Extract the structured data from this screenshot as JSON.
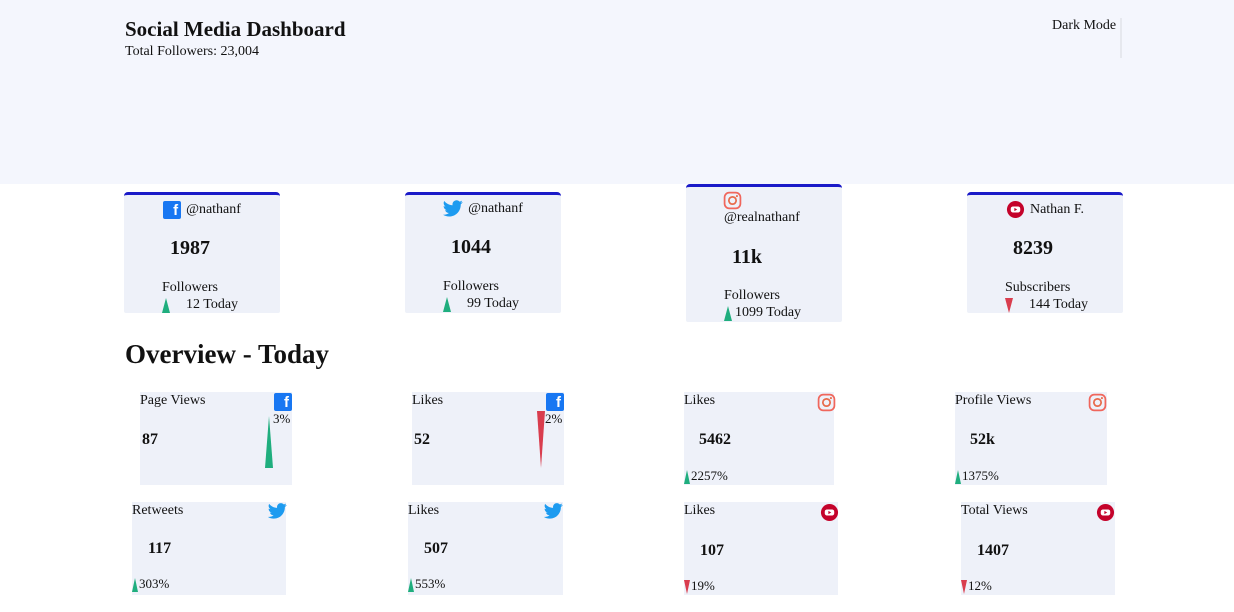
{
  "header": {
    "title": "Social Media Dashboard",
    "total_followers": "Total Followers: 23,004",
    "dark_mode_label": "Dark Mode"
  },
  "colors": {
    "card_accent": "#1a1ac8",
    "up": "#1fae7e",
    "down": "#d93d4e",
    "facebook": "#1877f2",
    "twitter": "#1d9bf0",
    "instagram": "#f58529",
    "youtube": "#c4032b"
  },
  "cards": [
    {
      "platform": "facebook",
      "icon": "facebook-icon",
      "handle": "@nathanf",
      "count": "1987",
      "unit": "Followers",
      "trend": "up",
      "today": "12 Today"
    },
    {
      "platform": "twitter",
      "icon": "twitter-icon",
      "handle": "@nathanf",
      "count": "1044",
      "unit": "Followers",
      "trend": "up",
      "today": "99 Today"
    },
    {
      "platform": "instagram",
      "icon": "instagram-icon",
      "handle": "@realnathanf",
      "count": "11k",
      "unit": "Followers",
      "trend": "up",
      "today": "1099 Today"
    },
    {
      "platform": "youtube",
      "icon": "youtube-icon",
      "handle": "Nathan F.",
      "count": "8239",
      "unit": "Subscribers",
      "trend": "down",
      "today": "144 Today"
    }
  ],
  "overview": {
    "title": "Overview - Today",
    "items": [
      {
        "label": "Page Views",
        "icon": "facebook-icon",
        "value": "87",
        "trend": "up",
        "pct": "3%"
      },
      {
        "label": "Likes",
        "icon": "facebook-icon",
        "value": "52",
        "trend": "down",
        "pct": "2%"
      },
      {
        "label": "Likes",
        "icon": "instagram-icon",
        "value": "5462",
        "trend": "up",
        "pct": "2257%"
      },
      {
        "label": "Profile Views",
        "icon": "instagram-icon",
        "value": "52k",
        "trend": "up",
        "pct": "1375%"
      },
      {
        "label": "Retweets",
        "icon": "twitter-icon",
        "value": "117",
        "trend": "up",
        "pct": "303%"
      },
      {
        "label": "Likes",
        "icon": "twitter-icon",
        "value": "507",
        "trend": "up",
        "pct": "553%"
      },
      {
        "label": "Likes",
        "icon": "youtube-icon",
        "value": "107",
        "trend": "down",
        "pct": "19%"
      },
      {
        "label": "Total Views",
        "icon": "youtube-icon",
        "value": "1407",
        "trend": "down",
        "pct": "12%"
      }
    ]
  }
}
